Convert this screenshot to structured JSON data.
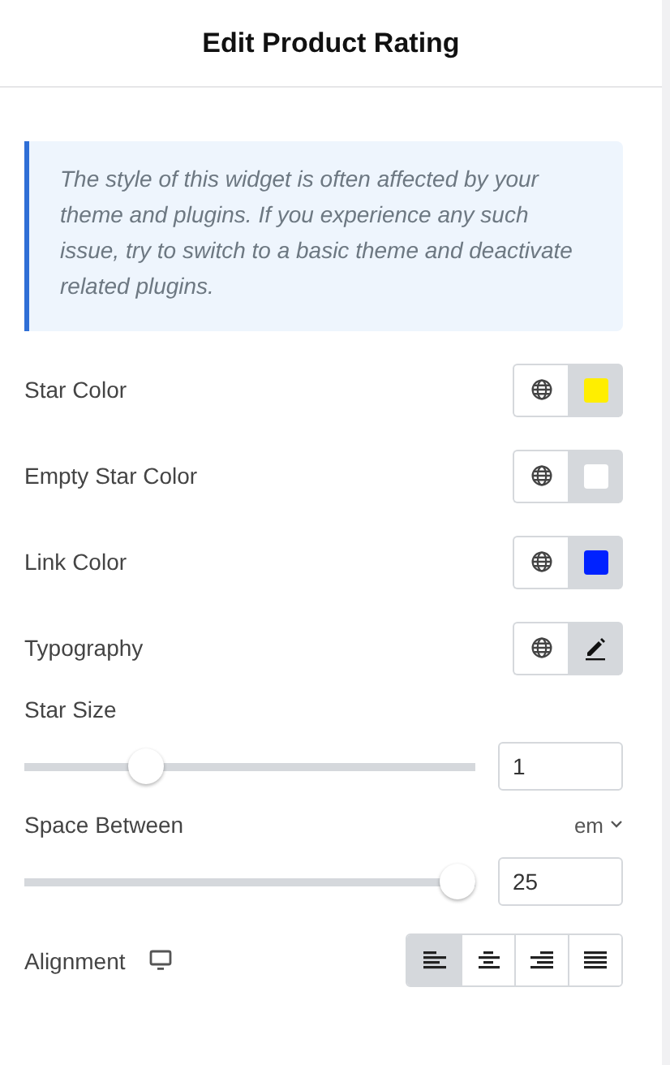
{
  "header": {
    "title": "Edit Product Rating"
  },
  "notice": {
    "text": "The style of this widget is often affected by your theme and plugins. If you experience any such issue, try to switch to a basic theme and deactivate related plugins."
  },
  "controls": [
    {
      "kind": "color",
      "label": "Star Color",
      "color": "#ffee00"
    },
    {
      "kind": "color",
      "label": "Empty Star Color",
      "color": "#ffffff"
    },
    {
      "kind": "color",
      "label": "Link Color",
      "color": "#0022ff"
    },
    {
      "kind": "typography",
      "label": "Typography"
    }
  ],
  "sliders": [
    {
      "label": "Star Size",
      "level": 0.25,
      "value": "1"
    },
    {
      "label": "Space Between",
      "unit": "em",
      "level": 1,
      "value": "25"
    }
  ],
  "alignment": {
    "label": "Alignment",
    "options": [
      {
        "kind": "left",
        "selected": true
      },
      {
        "kind": "center",
        "selected": false
      },
      {
        "kind": "right",
        "selected": false
      },
      {
        "kind": "justify",
        "selected": false
      }
    ]
  }
}
